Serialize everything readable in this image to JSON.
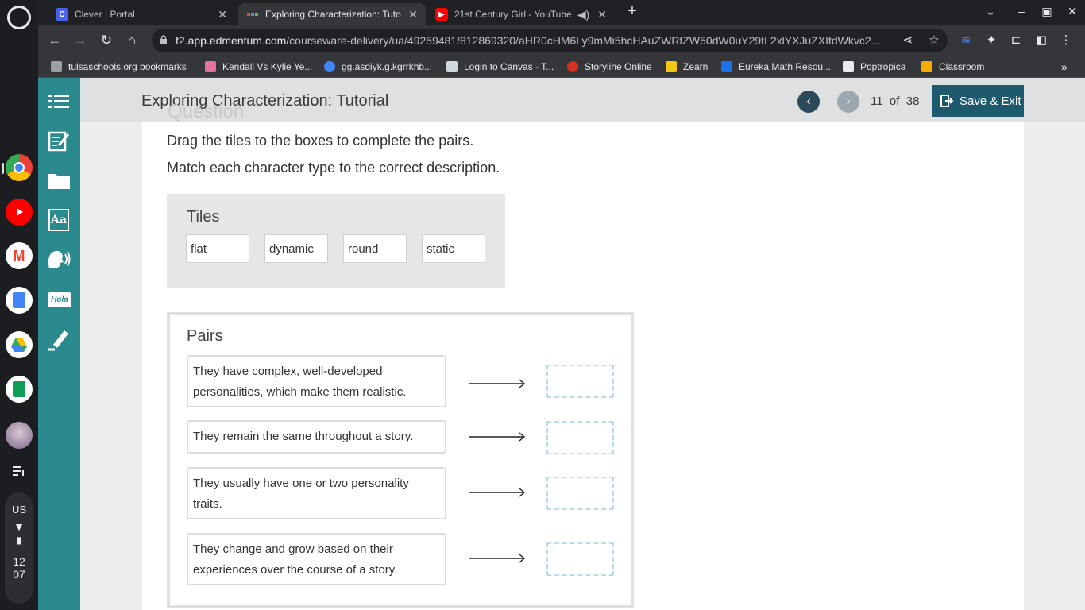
{
  "browser": {
    "tabs": [
      {
        "title": "Clever | Portal",
        "favicon": "clever-icon",
        "color": "#4a63e8",
        "active": false
      },
      {
        "title": "Exploring Characterization: Tuto",
        "favicon": "edmentum-icon",
        "color": "#e04b3c",
        "active": true
      },
      {
        "title": "21st Century Girl - YouTube",
        "favicon": "youtube-icon",
        "color": "#ff0000",
        "active": false
      }
    ],
    "url_host": "f2.app.edmentum.com",
    "url_path": "/courseware-delivery/ua/49259481/812869320/aHR0cHM6Ly9mMi5hcHAuZWRtZW50dW0uY29tL2xlYXJuZXItdWkvc2...",
    "bookmarks": [
      {
        "label": "tulsaschools.org bookmarks",
        "icon": "folder-icon",
        "color": "#9aa0a6"
      },
      {
        "label": "Kendall Vs Kylie Ye...",
        "icon": "bookmark-favicon",
        "color": "#e5739b"
      },
      {
        "label": "gg.asdiyk.g.kgrrkhb...",
        "icon": "google-icon",
        "color": "#4285f4"
      },
      {
        "label": "Login to Canvas - T...",
        "icon": "canvas-icon",
        "color": "#cfd8dc"
      },
      {
        "label": "Storyline Online",
        "icon": "storyline-icon",
        "color": "#d93025"
      },
      {
        "label": "Zearn",
        "icon": "zearn-icon",
        "color": "#f5c518"
      },
      {
        "label": "Eureka Math Resou...",
        "icon": "eureka-icon",
        "color": "#1a73e8"
      },
      {
        "label": "Poptropica",
        "icon": "poptropica-icon",
        "color": "#e8eaed"
      },
      {
        "label": "Classroom",
        "icon": "classroom-icon",
        "color": "#f9ab00"
      }
    ]
  },
  "system": {
    "locale": "US",
    "time_hour": "12",
    "time_min": "07"
  },
  "lesson": {
    "title": "Exploring Characterization: Tutorial",
    "current_page": "11",
    "of_label": "of",
    "total_pages": "38",
    "save_exit_label": "Save & Exit",
    "question_peek": "Question"
  },
  "question": {
    "instruction_1": "Drag the tiles to the boxes to complete the pairs.",
    "instruction_2": "Match each character type to the correct description.",
    "tiles_heading": "Tiles",
    "tiles": [
      "flat",
      "dynamic",
      "round",
      "static"
    ],
    "pairs_heading": "Pairs",
    "descriptions": [
      "They have complex, well-developed personalities, which make them realistic.",
      "They remain the same throughout a story.",
      "They usually have one or two personality traits.",
      "They change and grow based on their experiences over the course of a story."
    ]
  },
  "colors": {
    "rail": "#2a8a8e",
    "save_button": "#1d5a6e",
    "drop_border": "#b9dce8"
  }
}
